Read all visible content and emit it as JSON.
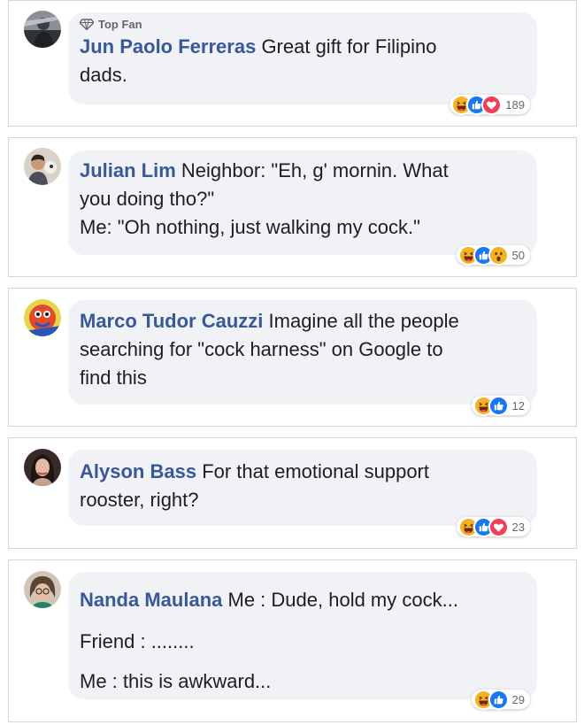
{
  "comments": [
    {
      "badge": "Top Fan",
      "author": "Jun Paolo Ferreras",
      "lines": [
        "Great gift for Filipino",
        "dads."
      ],
      "reactions": [
        "haha-icon",
        "like-icon",
        "love-icon"
      ],
      "count": "189"
    },
    {
      "author": "Julian Lim",
      "lines": [
        "Neighbor: \"Eh, g' mornin. What",
        "you doing tho?\"",
        "Me: \"Oh nothing, just walking my cock.\""
      ],
      "reactions": [
        "haha-icon",
        "like-icon",
        "wow-icon"
      ],
      "count": "50"
    },
    {
      "author": "Marco Tudor Cauzzi",
      "lines": [
        "Imagine all the people",
        "searching for \"cock harness\" on Google to",
        "find this"
      ],
      "reactions": [
        "haha-icon",
        "like-icon"
      ],
      "count": "12"
    },
    {
      "author": "Alyson Bass",
      "lines": [
        "For that emotional support",
        "rooster, right?"
      ],
      "reactions": [
        "haha-icon",
        "like-icon",
        "love-icon"
      ],
      "count": "23"
    },
    {
      "author": "Nanda Maulana",
      "lines": [
        "Me : Dude, hold my cock...",
        "Friend : ........",
        "Me : this is awkward..."
      ],
      "reactions": [
        "haha-icon",
        "like-icon"
      ],
      "count": "29"
    }
  ],
  "colors": {
    "author": "#385898",
    "bubble": "#f0f2f5",
    "like": "#1877f2",
    "love": "#f33e58",
    "haha": "#f7b125"
  }
}
